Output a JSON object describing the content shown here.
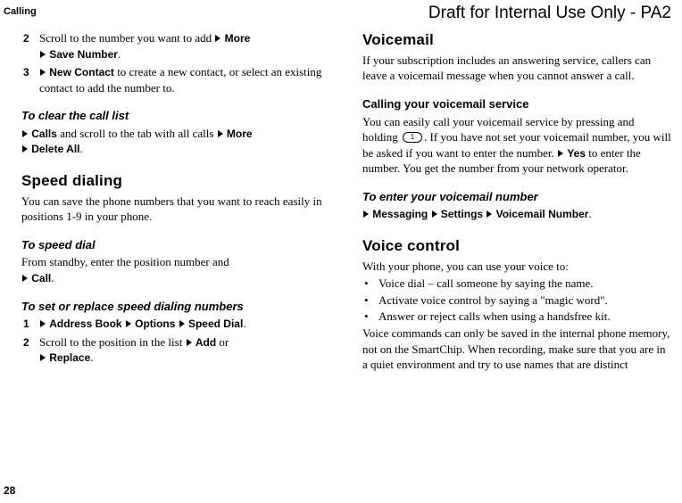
{
  "header": {
    "section": "Calling",
    "draft_notice": "Draft for Internal Use Only - PA2"
  },
  "page_number": "28",
  "left": {
    "steps_a": {
      "n2": "2",
      "s2a": "Scroll to the number you want to add ",
      "s2_more": "More",
      "s2_save": "Save Number",
      "s2_end": ".",
      "n3": "3",
      "s3_new": "New Contact",
      "s3_rest": " to create a new contact, or select an existing contact to add the number to."
    },
    "clear": {
      "heading": "To clear the call list",
      "calls": "Calls",
      "mid": " and scroll to the tab with all calls ",
      "more": "More",
      "delete": "Delete All",
      "end": "."
    },
    "speed": {
      "heading": "Speed dialing",
      "body": "You can save the phone numbers that you want to reach easily in positions 1-9 in your phone."
    },
    "speed_dial": {
      "heading": "To speed dial",
      "body": "From standby, enter the position number and ",
      "call": "Call",
      "end": "."
    },
    "speed_set": {
      "heading": "To set or replace speed dialing numbers",
      "n1": "1",
      "ab": "Address Book",
      "opt": "Options",
      "sd": "Speed Dial",
      "end1": ".",
      "n2": "2",
      "s2a": "Scroll to the position in the list ",
      "add": "Add",
      "or": " or ",
      "replace": "Replace",
      "end2": "."
    }
  },
  "right": {
    "vm": {
      "heading": "Voicemail",
      "body": "If your subscription includes an answering service, callers can leave a voicemail message when you cannot answer a call."
    },
    "vm_call": {
      "heading": "Calling your voicemail service",
      "p_a": "You can easily call your voicemail service by pressing and holding ",
      "key": "1",
      "p_b": ". If you have not set your voicemail number, you will be asked if you want to enter the number. ",
      "yes": "Yes",
      "p_c": " to enter the number. You get the number from your network operator."
    },
    "vm_enter": {
      "heading": "To enter your voicemail number",
      "msg": "Messaging",
      "set": "Settings",
      "vn": "Voicemail Number",
      "end": "."
    },
    "vc": {
      "heading": "Voice control",
      "intro": "With your phone, you can use your voice to:",
      "b1": "Voice dial – call someone by saying the name.",
      "b2": "Activate voice control by saying a \"magic word\".",
      "b3": "Answer or reject calls when using a handsfree kit.",
      "after": "Voice commands can only be saved in the internal phone memory, not on the SmartChip. When recording, make sure that you are in a quiet environment and try to use names that are distinct"
    }
  }
}
